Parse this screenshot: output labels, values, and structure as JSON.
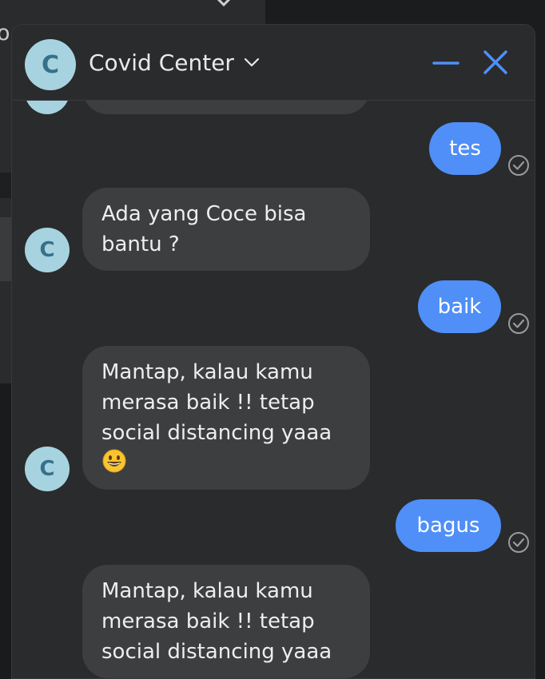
{
  "background": {
    "partial_text": "or  ."
  },
  "chat": {
    "title": "Covid Center",
    "avatar_letter": "C",
    "colors": {
      "accent": "#4f8ff7",
      "avatar_bg": "#a7d3e0",
      "avatar_fg": "#37708a",
      "incoming_bubble": "#3d3e40",
      "window_bg": "#2a2b2d"
    },
    "messages": [
      {
        "direction": "incoming",
        "text": ""
      },
      {
        "direction": "outgoing",
        "text": "tes",
        "status": "delivered"
      },
      {
        "direction": "incoming",
        "text": "Ada yang Coce bisa bantu ?"
      },
      {
        "direction": "outgoing",
        "text": "baik",
        "status": "delivered"
      },
      {
        "direction": "incoming",
        "text": "Mantap, kalau kamu merasa baik !! tetap social distancing yaaa",
        "emoji": "grinning-face"
      },
      {
        "direction": "outgoing",
        "text": "bagus",
        "status": "delivered"
      },
      {
        "direction": "incoming",
        "text": "Mantap, kalau kamu merasa baik !! tetap social distancing yaaa"
      }
    ]
  }
}
